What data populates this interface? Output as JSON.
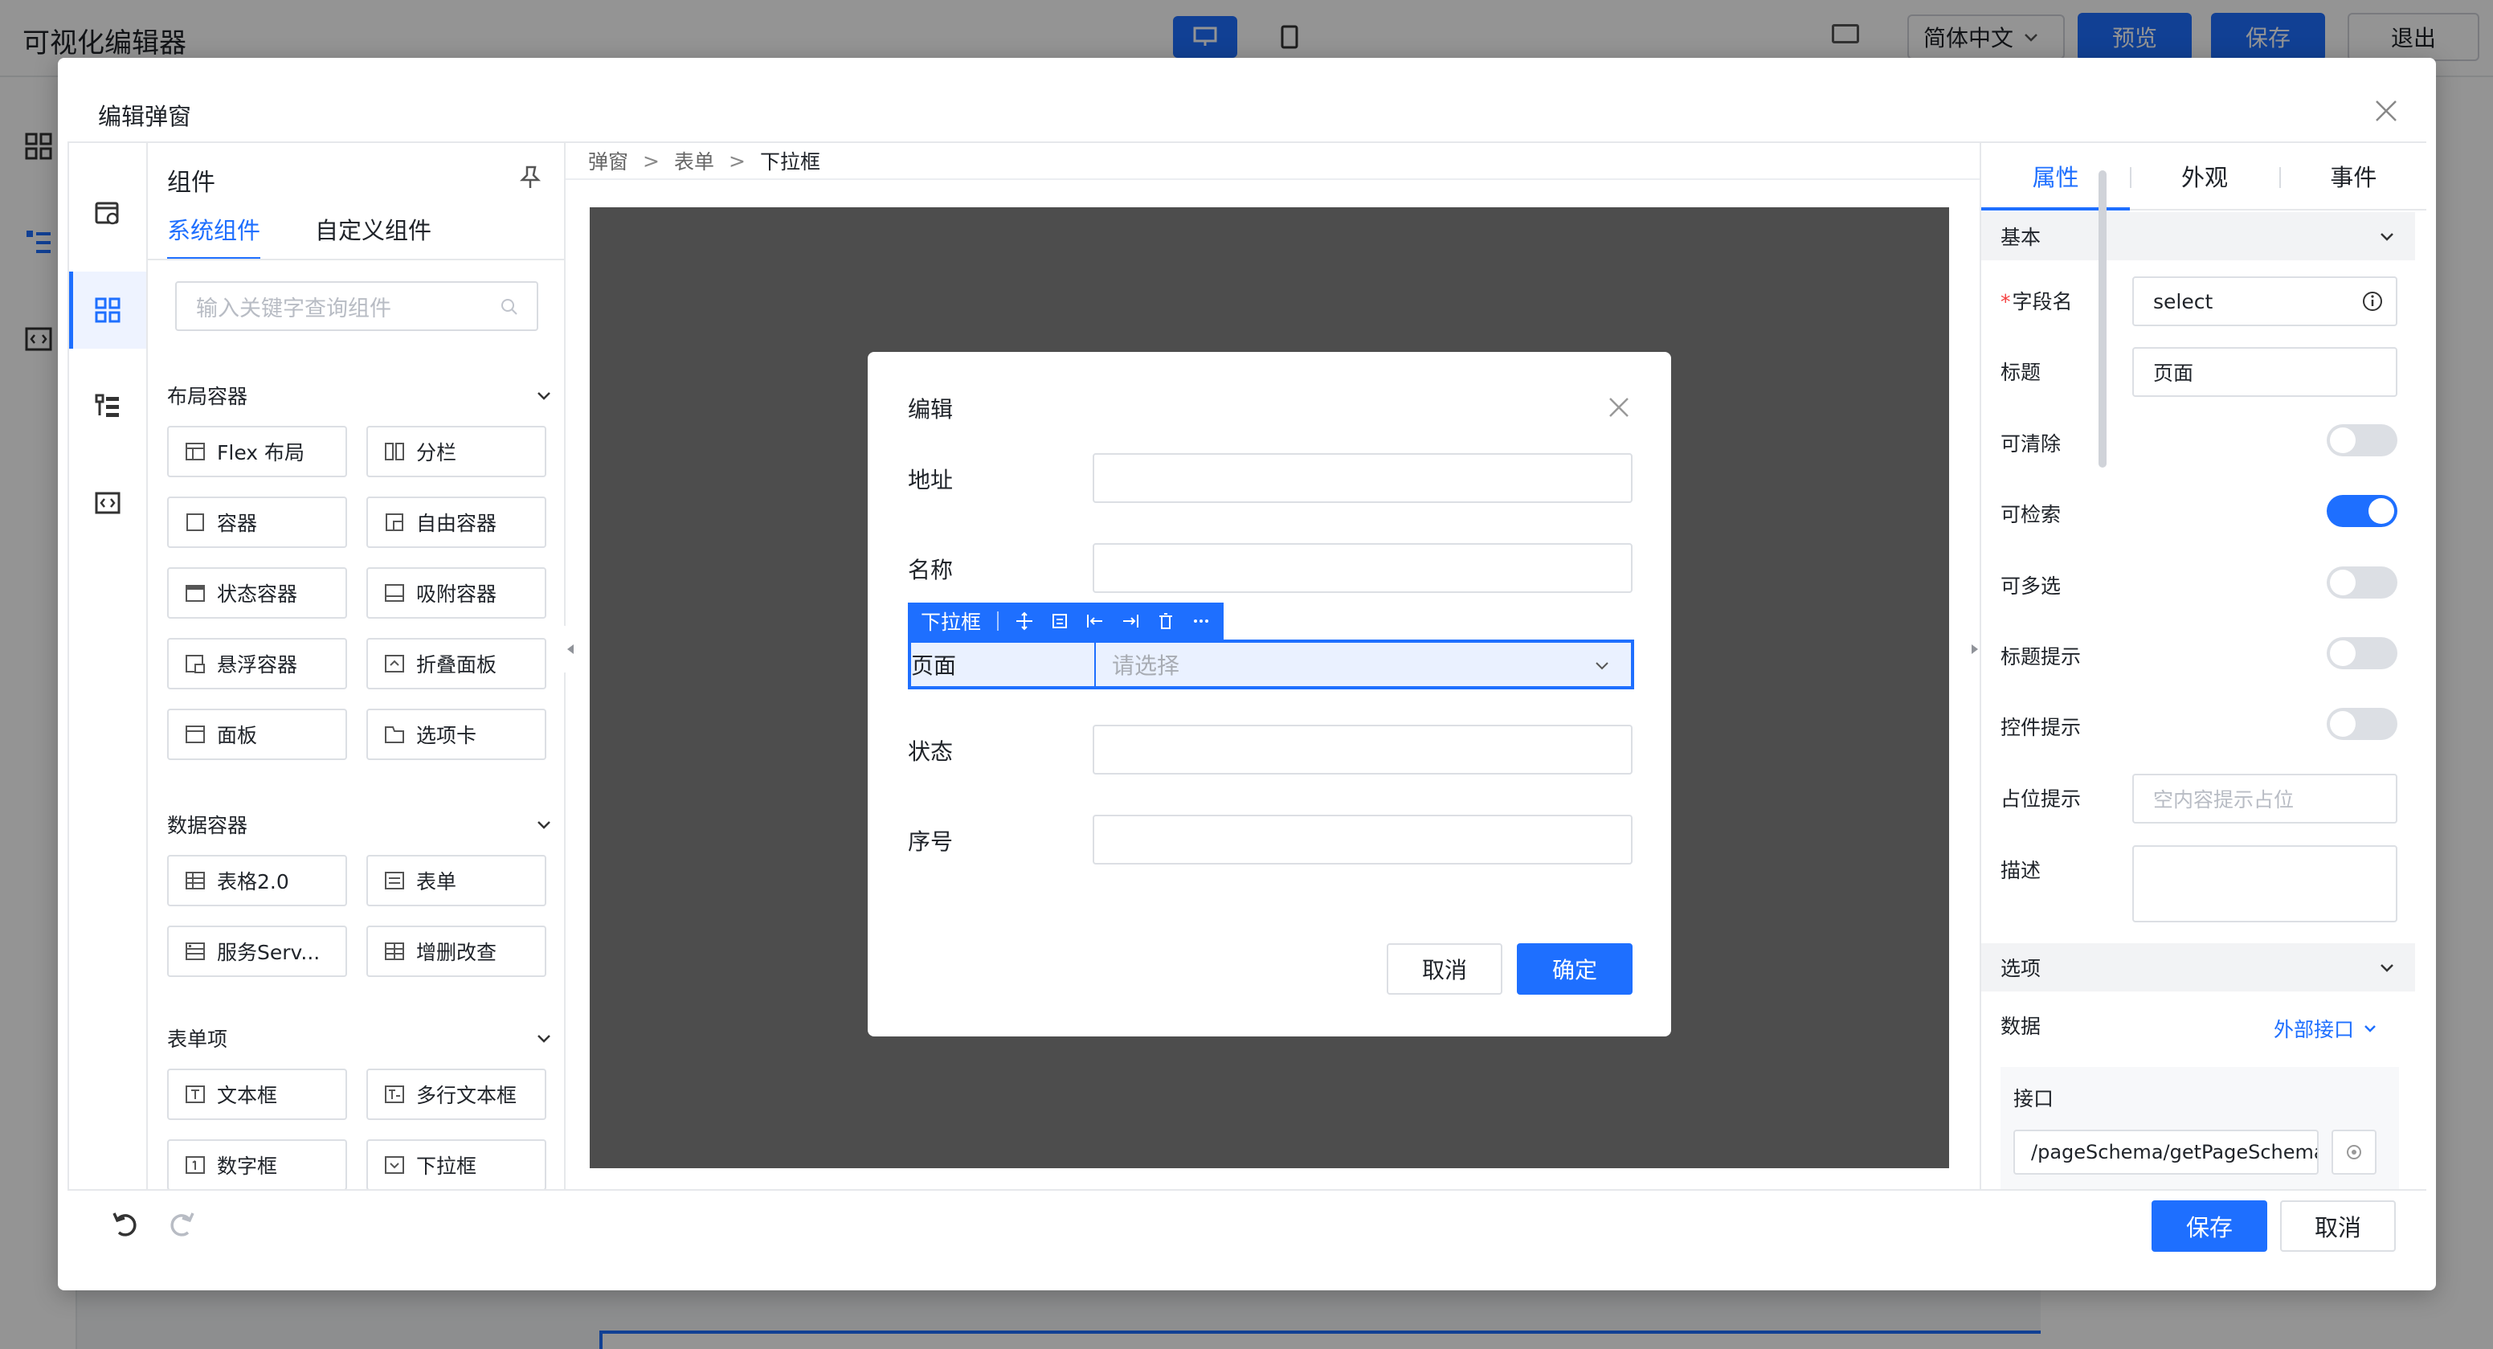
{
  "app": {
    "title": "可视化编辑器",
    "language": "简体中文",
    "preview_label": "预览",
    "save_label": "保存",
    "exit_label": "退出"
  },
  "dialog": {
    "title": "编辑弹窗",
    "save_label": "保存",
    "cancel_label": "取消"
  },
  "components": {
    "title": "组件",
    "tabs": [
      "系统组件",
      "自定义组件"
    ],
    "search_placeholder": "输入关键字查询组件",
    "groups": [
      {
        "title": "布局容器",
        "items": [
          "Flex 布局",
          "分栏",
          "容器",
          "自由容器",
          "状态容器",
          "吸附容器",
          "悬浮容器",
          "折叠面板",
          "面板",
          "选项卡"
        ]
      },
      {
        "title": "数据容器",
        "items": [
          "表格2.0",
          "表单",
          "服务Serv...",
          "增删改查"
        ]
      },
      {
        "title": "表单项",
        "items": [
          "文本框",
          "多行文本框",
          "数字框",
          "下拉框"
        ]
      }
    ]
  },
  "breadcrumb": [
    "弹窗",
    "表单",
    "下拉框"
  ],
  "breadcrumb_sep": ">",
  "modal": {
    "title": "编辑",
    "fields": [
      {
        "label": "地址"
      },
      {
        "label": "名称"
      },
      {
        "label": "页面",
        "placeholder": "请选择"
      },
      {
        "label": "状态"
      },
      {
        "label": "序号"
      }
    ],
    "toolbar_label": "下拉框",
    "cancel_label": "取消",
    "ok_label": "确定"
  },
  "props": {
    "tabs": [
      "属性",
      "外观",
      "事件"
    ],
    "basic": {
      "title": "基本",
      "field_name_label": "字段名",
      "field_name_value": "select",
      "title_label": "标题",
      "title_value": "页面",
      "clearable_label": "可清除",
      "clearable": false,
      "searchable_label": "可检索",
      "searchable": true,
      "multiple_label": "可多选",
      "multiple": false,
      "title_tip_label": "标题提示",
      "title_tip": false,
      "control_tip_label": "控件提示",
      "control_tip": false,
      "placeholder_label": "占位提示",
      "placeholder_value": "空内容提示占位",
      "desc_label": "描述"
    },
    "options": {
      "title": "选项",
      "data_label": "数据",
      "data_source": "外部接口",
      "api_label": "接口",
      "api_value": "/pageSchema/getPageSchema"
    }
  },
  "colors": {
    "primary": "#1e6fff",
    "required": "#f53f3f"
  }
}
